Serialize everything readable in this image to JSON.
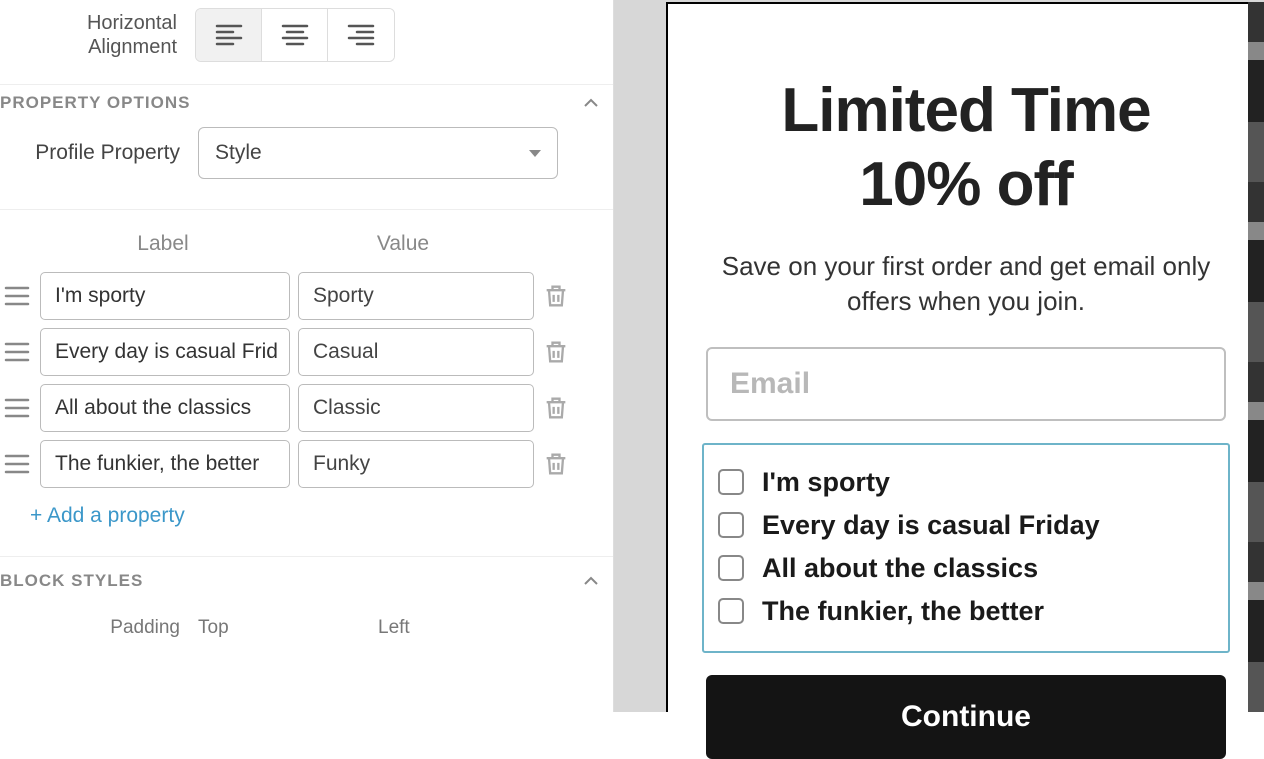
{
  "panel": {
    "alignment_label": "Horizontal Alignment",
    "section_property_options": "PROPERTY OPTIONS",
    "profile_property_label": "Profile Property",
    "profile_property_value": "Style",
    "table_head_label": "Label",
    "table_head_value": "Value",
    "add_property": "+ Add a property",
    "section_block_styles": "BLOCK STYLES",
    "padding_label": "Padding",
    "padding_top": "Top",
    "padding_left": "Left",
    "rows": [
      {
        "label": "I'm sporty",
        "value": "Sporty"
      },
      {
        "label": "Every day is casual Friday",
        "label_trunc": "Every day is casual Frid",
        "value": "Casual"
      },
      {
        "label": "All about the classics",
        "value": "Classic"
      },
      {
        "label": "The funkier, the better",
        "value": "Funky"
      }
    ]
  },
  "preview": {
    "title_line1": "Limited Time",
    "title_line2": "10% off",
    "subtitle": "Save on your first order and get email only offers when you join.",
    "email_placeholder": "Email",
    "options": [
      "I'm sporty",
      "Every day is casual Friday",
      "All about the classics",
      "The funkier, the better"
    ],
    "cta": "Continue"
  }
}
